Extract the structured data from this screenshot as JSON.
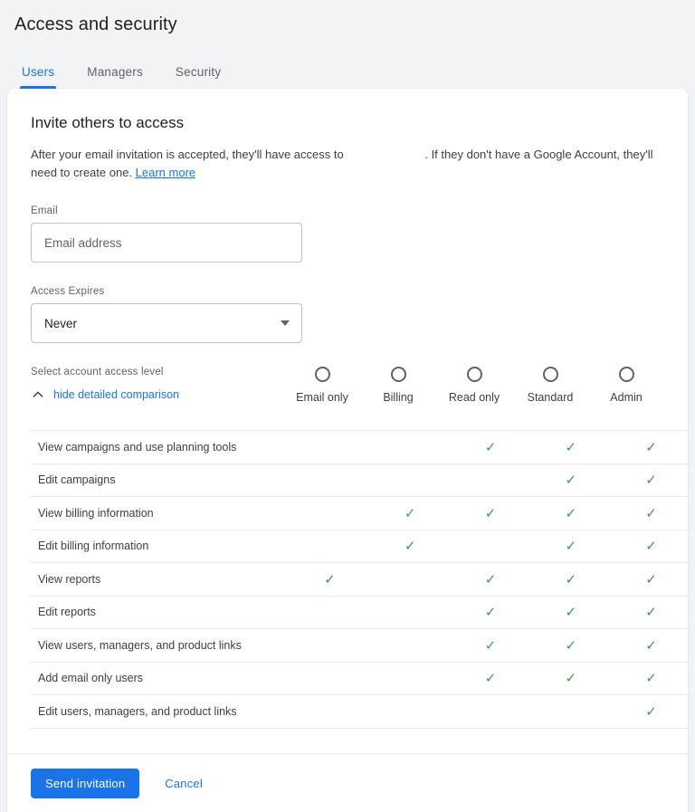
{
  "header": {
    "title": "Access and security"
  },
  "tabs": [
    {
      "label": "Users",
      "active": true
    },
    {
      "label": "Managers",
      "active": false
    },
    {
      "label": "Security",
      "active": false
    }
  ],
  "invite": {
    "section_title": "Invite others to access",
    "description_before": "After your email invitation is accepted, they'll have access to",
    "account_name": "",
    "description_after": ". If they don't have a Google Account, they'll need to create one.",
    "learn_more": "Learn more"
  },
  "form": {
    "email_label": "Email",
    "email_placeholder": "Email address",
    "email_value": "",
    "expires_label": "Access Expires",
    "expires_value": "Never",
    "expires_options": [
      "Never"
    ]
  },
  "access": {
    "caption": "Select account access level",
    "toggle_label": "hide detailed comparison",
    "levels": [
      {
        "label": "Email only",
        "selected": false
      },
      {
        "label": "Billing",
        "selected": false
      },
      {
        "label": "Read only",
        "selected": false
      },
      {
        "label": "Standard",
        "selected": false
      },
      {
        "label": "Admin",
        "selected": false
      }
    ]
  },
  "comparison": {
    "check_glyph": "✓",
    "check_color": "#3f9a52",
    "rows": [
      {
        "feature": "View campaigns and use planning tools",
        "marks": [
          false,
          false,
          true,
          true,
          true
        ]
      },
      {
        "feature": "Edit campaigns",
        "marks": [
          false,
          false,
          false,
          true,
          true
        ]
      },
      {
        "feature": "View billing information",
        "marks": [
          false,
          true,
          true,
          true,
          true
        ]
      },
      {
        "feature": "Edit billing information",
        "marks": [
          false,
          true,
          false,
          true,
          true
        ]
      },
      {
        "feature": "View reports",
        "marks": [
          true,
          false,
          true,
          true,
          true
        ]
      },
      {
        "feature": "Edit reports",
        "marks": [
          false,
          false,
          true,
          true,
          true
        ]
      },
      {
        "feature": "View users, managers, and product links",
        "marks": [
          false,
          false,
          true,
          true,
          true
        ]
      },
      {
        "feature": "Add email only users",
        "marks": [
          false,
          false,
          true,
          true,
          true
        ]
      },
      {
        "feature": "Edit users, managers, and product links",
        "marks": [
          false,
          false,
          false,
          false,
          true
        ]
      }
    ]
  },
  "footer": {
    "primary_label": "Send invitation",
    "secondary_label": "Cancel"
  },
  "colors": {
    "accent": "#1a73e8",
    "check": "#3f9a52",
    "page_bg": "#f1f3f4",
    "card_bg": "#ffffff",
    "divider": "#e8eaed"
  }
}
